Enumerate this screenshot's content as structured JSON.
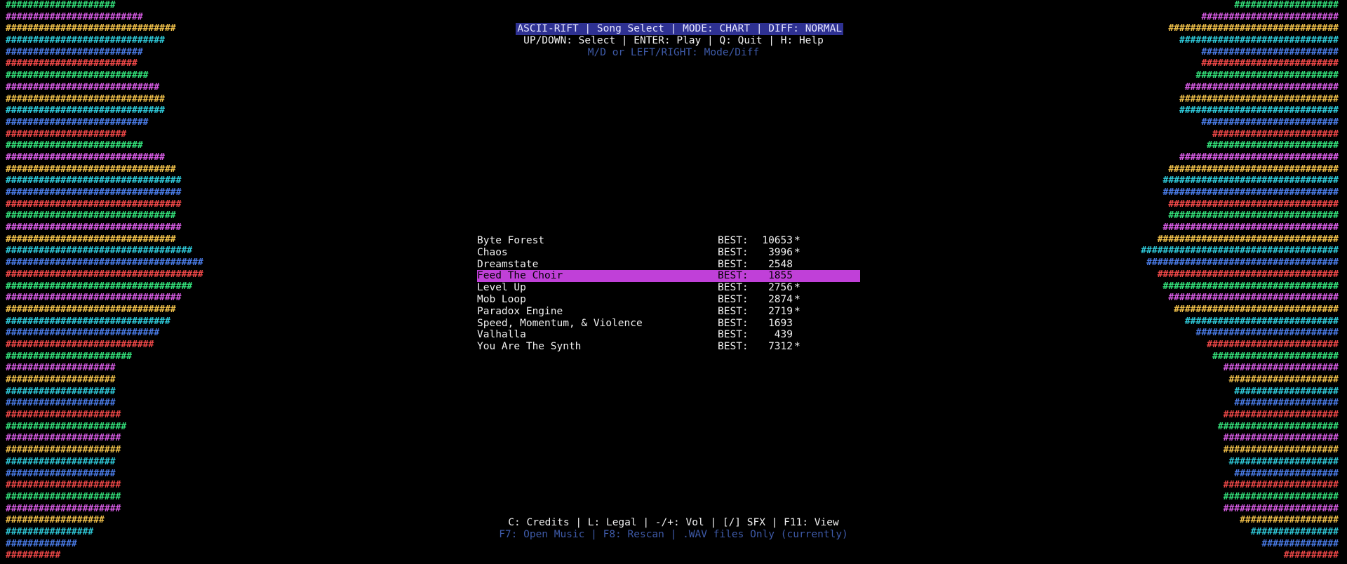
{
  "header": {
    "title": "ASCII-RIFT | Song Select | MODE: CHART | DIFF: NORMAL",
    "help": "UP/DOWN: Select | ENTER: Play | Q: Quit | H: Help",
    "help_sub": "M/D or LEFT/RIGHT: Mode/Diff"
  },
  "songs": [
    {
      "name": "Byte Forest",
      "best_label": "BEST:",
      "best": "10653",
      "star": "*",
      "selected": false
    },
    {
      "name": "Chaos",
      "best_label": "BEST:",
      "best": "3996",
      "star": "*",
      "selected": false
    },
    {
      "name": "Dreamstate",
      "best_label": "BEST:",
      "best": "2548",
      "star": "",
      "selected": false
    },
    {
      "name": "Feed The Choir",
      "best_label": "BEST:",
      "best": "1855",
      "star": "",
      "selected": true
    },
    {
      "name": "Level Up",
      "best_label": "BEST:",
      "best": "2756",
      "star": "*",
      "selected": false
    },
    {
      "name": "Mob Loop",
      "best_label": "BEST:",
      "best": "2874",
      "star": "*",
      "selected": false
    },
    {
      "name": "Paradox Engine",
      "best_label": "BEST:",
      "best": "2719",
      "star": "*",
      "selected": false
    },
    {
      "name": "Speed, Momentum, & Violence",
      "best_label": "BEST:",
      "best": "1693",
      "star": "",
      "selected": false
    },
    {
      "name": "Valhalla",
      "best_label": "BEST:",
      "best": "439",
      "star": "",
      "selected": false
    },
    {
      "name": "You Are The Synth",
      "best_label": "BEST:",
      "best": "7312",
      "star": "*",
      "selected": false
    }
  ],
  "footer": {
    "line": "C: Credits | L: Legal | -/+: Vol | [/] SFX | F11: View",
    "sub": "F7: Open Music | F8: Rescan | .WAV files Only (currently)"
  },
  "colors": {
    "title_bg": "#2e3192",
    "title_fg": "#e6e6ff",
    "selected_bg": "#c040d8",
    "selected_fg": "#000000",
    "dim_text": "#3e5aa8",
    "text": "#f0f0f0",
    "bar_palette": [
      "#33e07a",
      "#d95ce6",
      "#f0c04a",
      "#2ec8d8",
      "#4a7ce8",
      "#f04848"
    ]
  },
  "visualizer": {
    "left_lengths": [
      20,
      25,
      31,
      29,
      25,
      24,
      26,
      28,
      29,
      29,
      26,
      22,
      25,
      29,
      31,
      32,
      32,
      32,
      31,
      32,
      31,
      34,
      36,
      36,
      34,
      32,
      31,
      30,
      28,
      27,
      23,
      20,
      20,
      20,
      20,
      21,
      22,
      21,
      21,
      20,
      20,
      21,
      21,
      21,
      18,
      16,
      13,
      10
    ],
    "left_colors": [
      0,
      1,
      2,
      3,
      4,
      5,
      0,
      1,
      2,
      3,
      4,
      5,
      0,
      1,
      2,
      3,
      4,
      5,
      0,
      1,
      2,
      3,
      4,
      5,
      0,
      1,
      2,
      3,
      4,
      5,
      0,
      1,
      2,
      3,
      4,
      5,
      0,
      1,
      2,
      3,
      4,
      5,
      0,
      1,
      2,
      3,
      4,
      5
    ],
    "right_lengths": [
      19,
      25,
      31,
      29,
      25,
      25,
      26,
      28,
      29,
      29,
      25,
      23,
      24,
      29,
      31,
      32,
      32,
      31,
      31,
      32,
      33,
      36,
      35,
      33,
      32,
      31,
      30,
      28,
      26,
      24,
      23,
      21,
      20,
      19,
      19,
      21,
      22,
      21,
      21,
      20,
      19,
      21,
      21,
      21,
      18,
      16,
      14,
      10
    ],
    "right_colors": [
      0,
      1,
      2,
      3,
      4,
      5,
      0,
      1,
      2,
      3,
      4,
      5,
      0,
      1,
      2,
      3,
      4,
      5,
      0,
      1,
      2,
      3,
      4,
      5,
      0,
      1,
      2,
      3,
      4,
      5,
      0,
      1,
      2,
      3,
      4,
      5,
      0,
      1,
      2,
      3,
      4,
      5,
      0,
      1,
      2,
      3,
      4,
      5
    ]
  }
}
